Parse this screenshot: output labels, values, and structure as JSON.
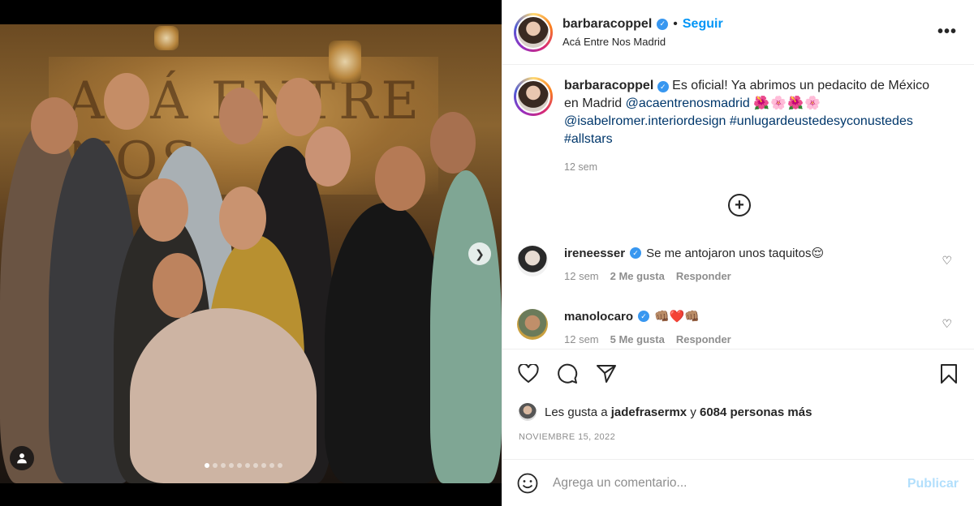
{
  "post": {
    "username": "barbaracoppel",
    "follow_label": "Seguir",
    "separator": "•",
    "location": "Acá Entre Nos Madrid",
    "more_label": "•••"
  },
  "photo": {
    "sign_text": "ACÁ ENTRE NOS",
    "carousel_slides": 10,
    "active_slide": 1
  },
  "caption": {
    "username": "barbaracoppel",
    "text_1": "Es oficial! Ya abrimos un pedacito de México en Madrid",
    "mention_1": "@acaentrenosmadrid",
    "flowers": "🌺🌸🌺🌸",
    "mention_2": "@isabelromer.interiordesign",
    "hashtag_1": "#unlugardeustedesyconustedes",
    "hashtag_2": "#allstars",
    "time": "12 sem"
  },
  "comments": [
    {
      "username": "ireneesser",
      "text": "Se me antojaron unos taquitos😌",
      "time": "12 sem",
      "likes": "2 Me gusta",
      "reply": "Responder"
    },
    {
      "username": "manolocaro",
      "text": "👊🏽❤️👊🏽",
      "time": "12 sem",
      "likes": "5 Me gusta",
      "reply": "Responder"
    }
  ],
  "likes": {
    "prefix": "Les gusta a",
    "user": "jadefrasermx",
    "joiner": "y",
    "others": "6084 personas más"
  },
  "date": "NOVIEMBRE 15, 2022",
  "add_comment": {
    "placeholder": "Agrega un comentario...",
    "publish_label": "Publicar"
  },
  "colors": {
    "link": "#00376b",
    "follow": "#0095f6",
    "verified": "#3897f0",
    "meta": "#8e8e8e",
    "publish_disabled": "#b2dffc"
  }
}
